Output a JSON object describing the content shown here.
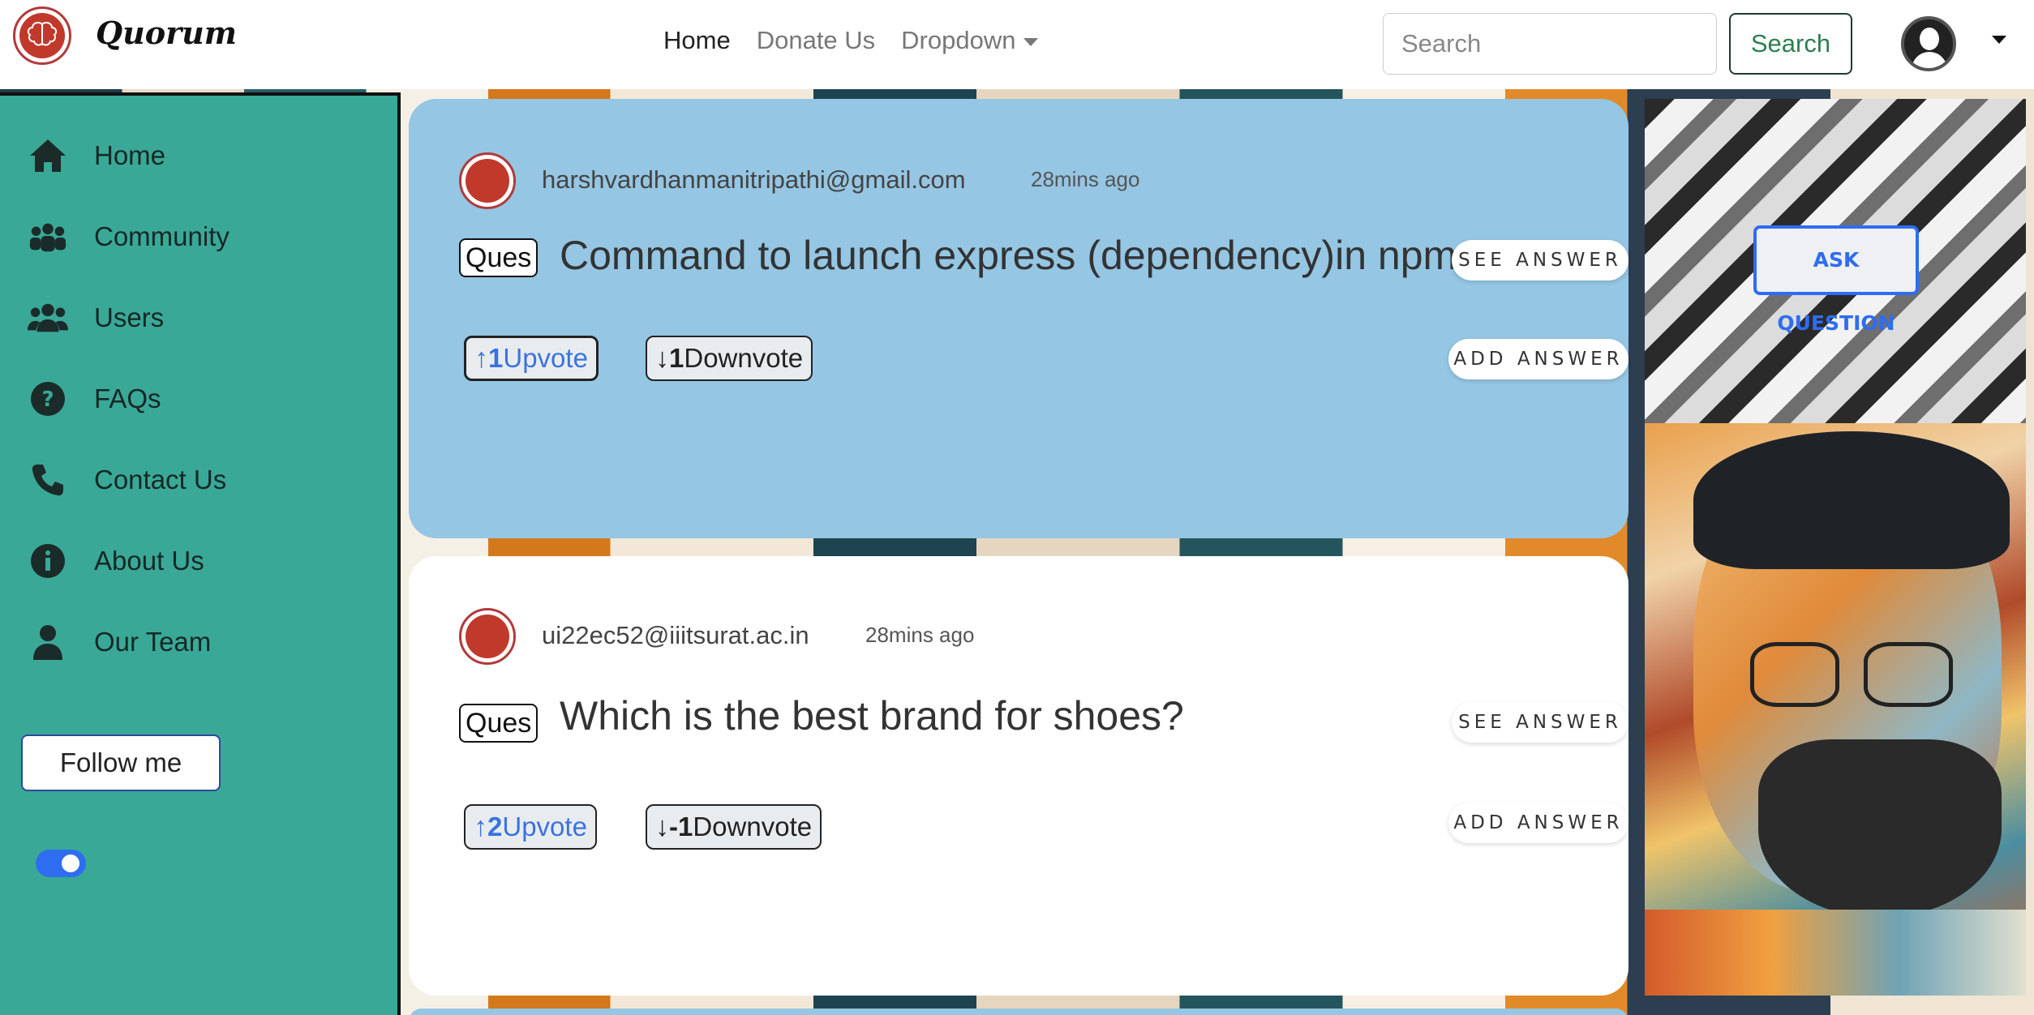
{
  "navbar": {
    "brand": "Quorum",
    "links": [
      {
        "label": "Home"
      },
      {
        "label": "Donate Us"
      },
      {
        "label": "Dropdown"
      }
    ],
    "search_placeholder": "Search",
    "search_button": "Search"
  },
  "sidebar": {
    "items": [
      {
        "label": "Home",
        "icon": "home-icon"
      },
      {
        "label": "Community",
        "icon": "community-icon"
      },
      {
        "label": "Users",
        "icon": "users-icon"
      },
      {
        "label": "FAQs",
        "icon": "question-icon"
      },
      {
        "label": "Contact Us",
        "icon": "phone-icon"
      },
      {
        "label": "About Us",
        "icon": "info-icon"
      },
      {
        "label": "Our Team",
        "icon": "person-icon"
      }
    ],
    "follow_button": "Follow me",
    "toggle_on": true
  },
  "questions": [
    {
      "email": "harshvardhanmanitripathi@gmail.com",
      "time": "28mins ago",
      "tag": "Ques",
      "text": "Command to launch express (dependency)in npm?",
      "upvote_arrow": "↑",
      "upvote_count": "1",
      "upvote_label": "Upvote",
      "downvote_arrow": "↓",
      "downvote_count": "1",
      "downvote_label": "Downvote",
      "see_answer": "SEE ANSWER",
      "add_answer": "ADD ANSWER"
    },
    {
      "email": "ui22ec52@iiitsurat.ac.in",
      "time": "28mins ago",
      "tag": "Ques",
      "text": "Which is the best brand for shoes?",
      "upvote_arrow": "↑",
      "upvote_count": "2",
      "upvote_label": "Upvote",
      "downvote_arrow": "↓",
      "downvote_count": "-1",
      "downvote_label": "Downvote",
      "see_answer": "SEE ANSWER",
      "add_answer": "ADD ANSWER"
    }
  ],
  "right_panel": {
    "ask_button": "ASK QUESTION"
  },
  "colors": {
    "sidebar_bg": "#3aa896",
    "card_highlight": "#95c6e3",
    "accent_blue": "#2f6df0"
  }
}
